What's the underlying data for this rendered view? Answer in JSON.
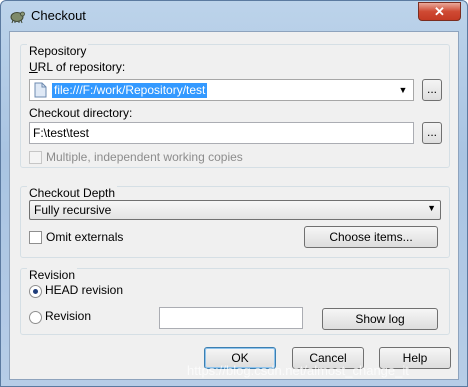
{
  "window": {
    "title": "Checkout",
    "close_label": "✕"
  },
  "repository": {
    "group_label": "Repository",
    "url_label": "URL of repository:",
    "url_value": "file:///F:/work/Repository/test",
    "checkout_dir_label": "Checkout directory:",
    "checkout_dir_value": "F:\\test\\test",
    "browse_label": "...",
    "multiple_copies_label": "Multiple, independent working copies"
  },
  "depth": {
    "group_label": "Checkout Depth",
    "selected": "Fully recursive",
    "omit_externals_label": "Omit externals",
    "choose_items_label": "Choose items..."
  },
  "revision": {
    "group_label": "Revision",
    "head_label": "HEAD revision",
    "revision_label": "Revision",
    "revision_value": "",
    "show_log_label": "Show log"
  },
  "buttons": {
    "ok": "OK",
    "cancel": "Cancel",
    "help": "Help"
  },
  "watermark": "https://blog.csdn.net/almost_change_it"
}
